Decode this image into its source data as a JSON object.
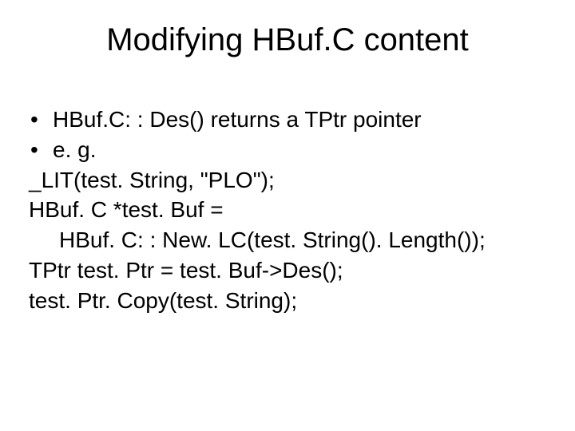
{
  "title": "Modifying HBuf.C content",
  "bullets": [
    "HBuf.C: : Des() returns a TPtr pointer",
    "e. g."
  ],
  "lines": [
    "_LIT(test. String, \"PLO\");",
    "HBuf. C *test. Buf =",
    "HBuf. C: : New. LC(test. String(). Length());",
    "TPtr test. Ptr = test. Buf->Des();",
    "test. Ptr. Copy(test. String);"
  ]
}
